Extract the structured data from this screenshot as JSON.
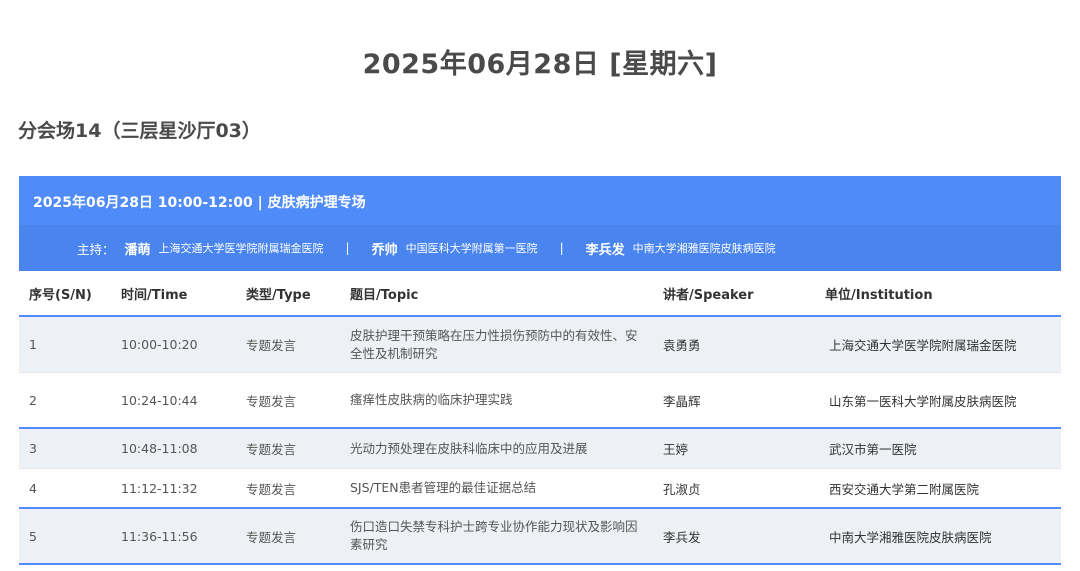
{
  "page": {
    "date_title": "2025年06月28日 [星期六]",
    "venue": "分会场14（三层星沙厅03）"
  },
  "session": {
    "title": "2025年06月28日 10:00-12:00 | 皮肤病护理专场",
    "host_label": "主持：",
    "separator": "|",
    "hosts": [
      {
        "name": "潘萌",
        "institution": "上海交通大学医学院附属瑞金医院"
      },
      {
        "name": "乔帅",
        "institution": "中国医科大学附属第一医院"
      },
      {
        "name": "李兵发",
        "institution": "中南大学湘雅医院皮肤病医院"
      }
    ]
  },
  "table": {
    "headers": [
      "序号(S/N)",
      "时间/Time",
      "类型/Type",
      "题目/Topic",
      "讲者/Speaker",
      "单位/Institution"
    ],
    "rows": [
      {
        "sn": "1",
        "time": "10:00-10:20",
        "type": "专题发言",
        "topic": "皮肤护理干预策略在压力性损伤预防中的有效性、安全性及机制研究",
        "speaker": "袁勇勇",
        "institution": "上海交通大学医学院附属瑞金医院"
      },
      {
        "sn": "2",
        "time": "10:24-10:44",
        "type": "专题发言",
        "topic": "瘙痒性皮肤病的临床护理实践",
        "speaker": "李晶辉",
        "institution": "山东第一医科大学附属皮肤病医院"
      },
      {
        "sn": "3",
        "time": "10:48-11:08",
        "type": "专题发言",
        "topic": "光动力预处理在皮肤科临床中的应用及进展",
        "speaker": "王婷",
        "institution": "武汉市第一医院"
      },
      {
        "sn": "4",
        "time": "11:12-11:32",
        "type": "专题发言",
        "topic": "SJS/TEN患者管理的最佳证据总结",
        "speaker": "孔淑贞",
        "institution": "西安交通大学第二附属医院"
      },
      {
        "sn": "5",
        "time": "11:36-11:56",
        "type": "专题发言",
        "topic": "伤口造口失禁专科护士跨专业协作能力现状及影响因素研究",
        "speaker": "李兵发",
        "institution": "中南大学湘雅医院皮肤病医院"
      }
    ]
  },
  "colors": {
    "header_blue": "#4f8bf9",
    "host_bar_blue": "#4a84ee",
    "alt_row": "#edf1f5"
  }
}
